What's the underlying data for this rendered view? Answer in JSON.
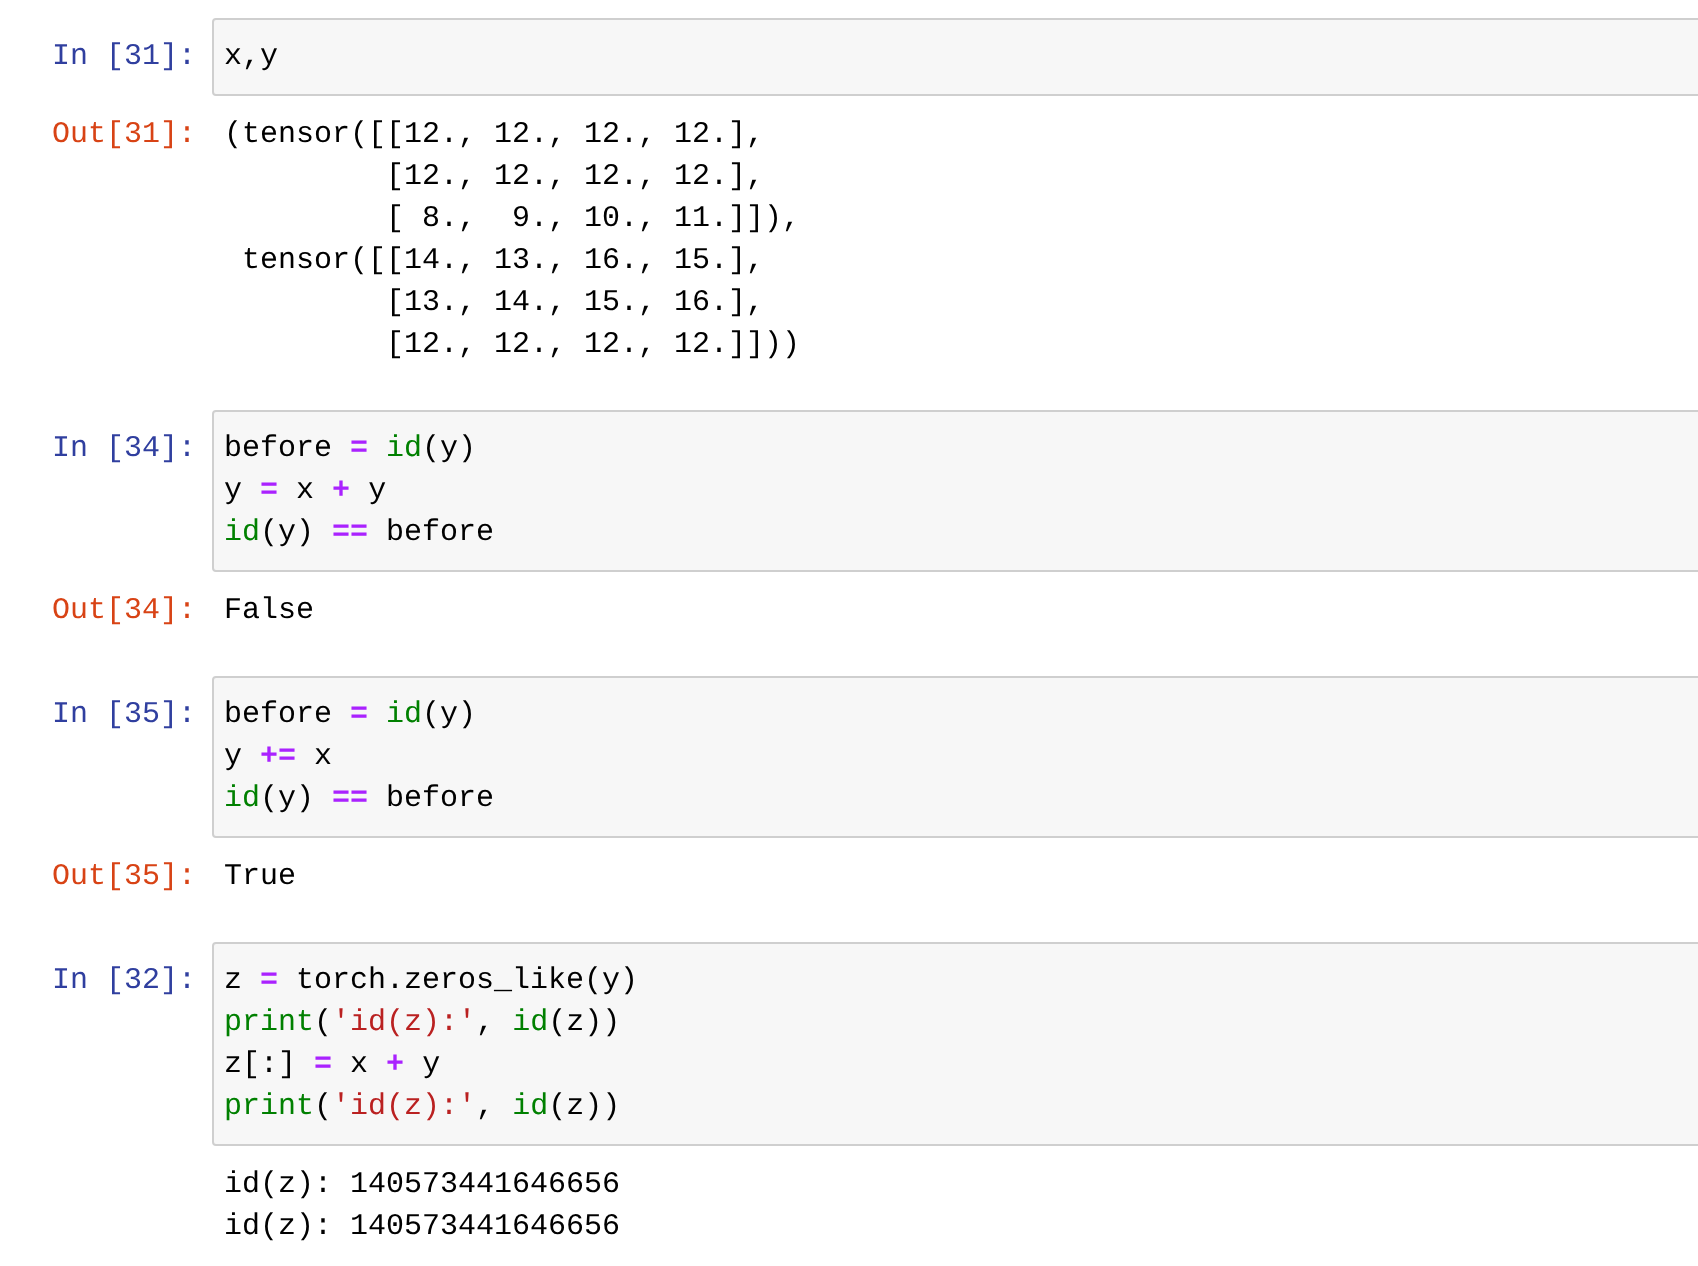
{
  "cells": [
    {
      "input_prompt": "In [31]:",
      "code_lines": [
        [
          {
            "kind": "plain",
            "t": "x,y"
          }
        ]
      ],
      "output_prompt": "Out[31]:",
      "output_lines": [
        "(tensor([[12., 12., 12., 12.],",
        "         [12., 12., 12., 12.],",
        "         [ 8.,  9., 10., 11.]]),",
        " tensor([[14., 13., 16., 15.],",
        "         [13., 14., 15., 16.],",
        "         [12., 12., 12., 12.]]))"
      ]
    },
    {
      "input_prompt": "In [34]:",
      "code_lines": [
        [
          {
            "kind": "plain",
            "t": "before "
          },
          {
            "kind": "op",
            "t": "= "
          },
          {
            "kind": "builtin",
            "t": "id"
          },
          {
            "kind": "plain",
            "t": "(y)"
          }
        ],
        [
          {
            "kind": "plain",
            "t": "y "
          },
          {
            "kind": "op",
            "t": "= "
          },
          {
            "kind": "plain",
            "t": "x "
          },
          {
            "kind": "op",
            "t": "+ "
          },
          {
            "kind": "plain",
            "t": "y"
          }
        ],
        [
          {
            "kind": "builtin",
            "t": "id"
          },
          {
            "kind": "plain",
            "t": "(y) "
          },
          {
            "kind": "op",
            "t": "== "
          },
          {
            "kind": "plain",
            "t": "before"
          }
        ]
      ],
      "output_prompt": "Out[34]:",
      "output_lines": [
        "False"
      ]
    },
    {
      "input_prompt": "In [35]:",
      "code_lines": [
        [
          {
            "kind": "plain",
            "t": "before "
          },
          {
            "kind": "op",
            "t": "= "
          },
          {
            "kind": "builtin",
            "t": "id"
          },
          {
            "kind": "plain",
            "t": "(y)"
          }
        ],
        [
          {
            "kind": "plain",
            "t": "y "
          },
          {
            "kind": "op",
            "t": "+= "
          },
          {
            "kind": "plain",
            "t": "x"
          }
        ],
        [
          {
            "kind": "builtin",
            "t": "id"
          },
          {
            "kind": "plain",
            "t": "(y) "
          },
          {
            "kind": "op",
            "t": "== "
          },
          {
            "kind": "plain",
            "t": "before"
          }
        ]
      ],
      "output_prompt": "Out[35]:",
      "output_lines": [
        "True"
      ]
    },
    {
      "input_prompt": "In [32]:",
      "code_lines": [
        [
          {
            "kind": "plain",
            "t": "z "
          },
          {
            "kind": "op",
            "t": "= "
          },
          {
            "kind": "plain",
            "t": "torch.zeros_like(y)"
          }
        ],
        [
          {
            "kind": "builtin",
            "t": "print"
          },
          {
            "kind": "plain",
            "t": "("
          },
          {
            "kind": "str",
            "t": "'id(z):'"
          },
          {
            "kind": "plain",
            "t": ", "
          },
          {
            "kind": "builtin",
            "t": "id"
          },
          {
            "kind": "plain",
            "t": "(z))"
          }
        ],
        [
          {
            "kind": "plain",
            "t": "z[:] "
          },
          {
            "kind": "op",
            "t": "= "
          },
          {
            "kind": "plain",
            "t": "x "
          },
          {
            "kind": "op",
            "t": "+ "
          },
          {
            "kind": "plain",
            "t": "y"
          }
        ],
        [
          {
            "kind": "builtin",
            "t": "print"
          },
          {
            "kind": "plain",
            "t": "("
          },
          {
            "kind": "str",
            "t": "'id(z):'"
          },
          {
            "kind": "plain",
            "t": ", "
          },
          {
            "kind": "builtin",
            "t": "id"
          },
          {
            "kind": "plain",
            "t": "(z))"
          }
        ]
      ],
      "output_lines": [
        "id(z): 140573441646656",
        "id(z): 140573441646656"
      ]
    }
  ]
}
